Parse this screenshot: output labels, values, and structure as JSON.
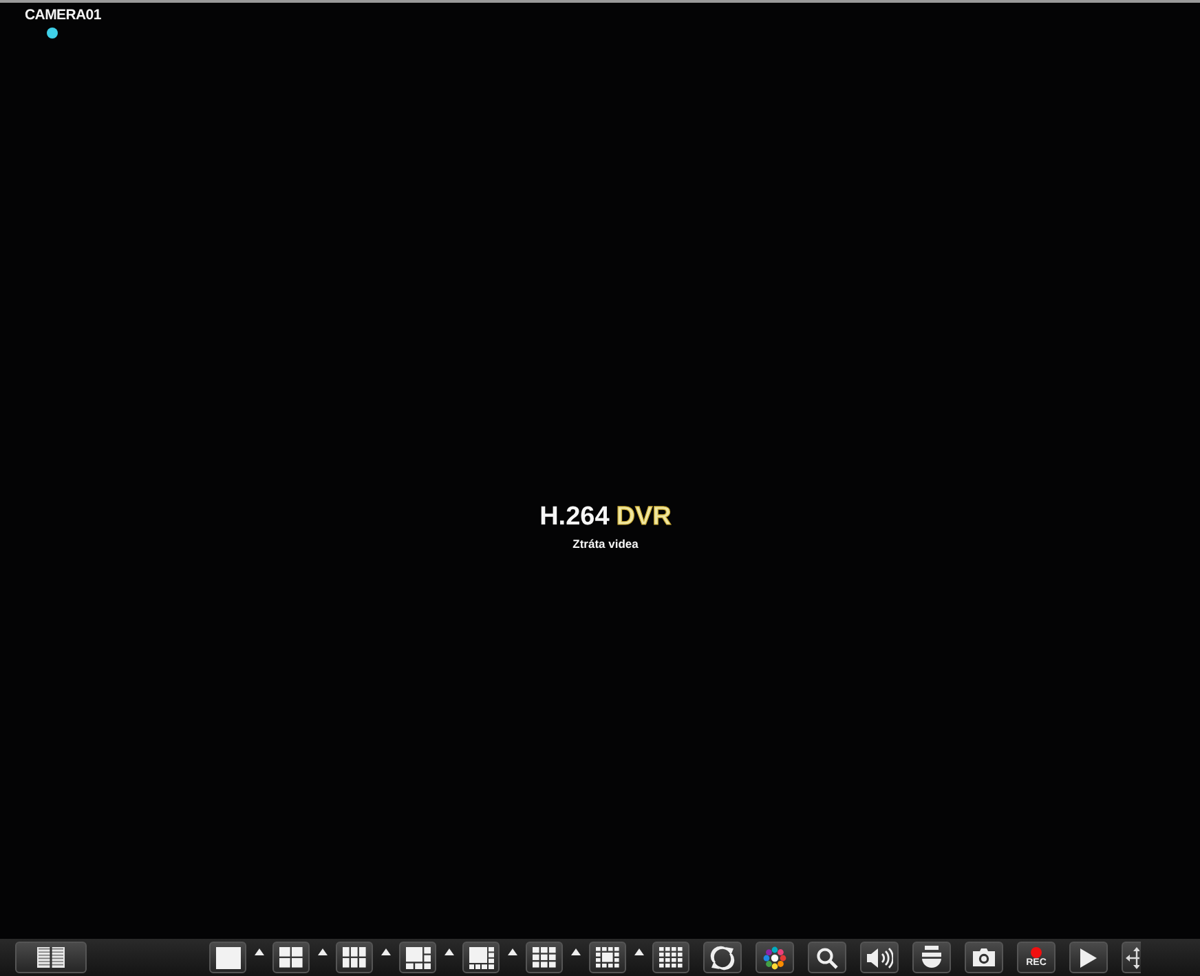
{
  "camera": {
    "name": "CAMERA01"
  },
  "logo": {
    "codec": "H.264",
    "brand": "DVR"
  },
  "message": "Ztráta videa",
  "toolbar": {
    "record_label": "REC"
  }
}
